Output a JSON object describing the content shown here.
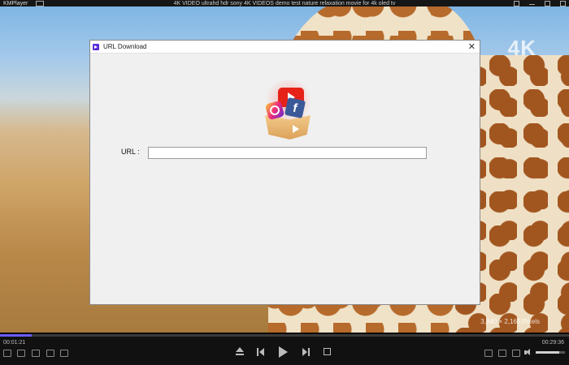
{
  "window": {
    "app_name": "KMPlayer",
    "title": "4K VIDEO ultrahd hdr sony 4K VIDEOS demo test nature relaxation movie for 4k oled tv"
  },
  "video": {
    "badge": "4K",
    "resolution": "3,840 × 2,160 Pixels"
  },
  "dialog": {
    "title": "URL Download",
    "close_label": "✕",
    "url_label": "URL :",
    "url_value": "",
    "illustration_brands": [
      "youtube",
      "instagram",
      "facebook"
    ],
    "facebook_glyph": "f"
  },
  "player": {
    "current_time": "00:01:21",
    "total_time": "00:29:36",
    "progress": 0.055,
    "volume": 0.8,
    "accent_color": "#6b5cff",
    "left_controls": [
      "playlist-icon",
      "subtitle-icon",
      "capture-icon",
      "3d-icon",
      "screen-icon"
    ],
    "transport": [
      "eject-icon",
      "previous-icon",
      "play-icon",
      "next-icon",
      "stop-icon"
    ],
    "right_controls": [
      "subtitle-toggle-icon",
      "audio-track-icon",
      "speed-icon",
      "volume-icon"
    ]
  }
}
